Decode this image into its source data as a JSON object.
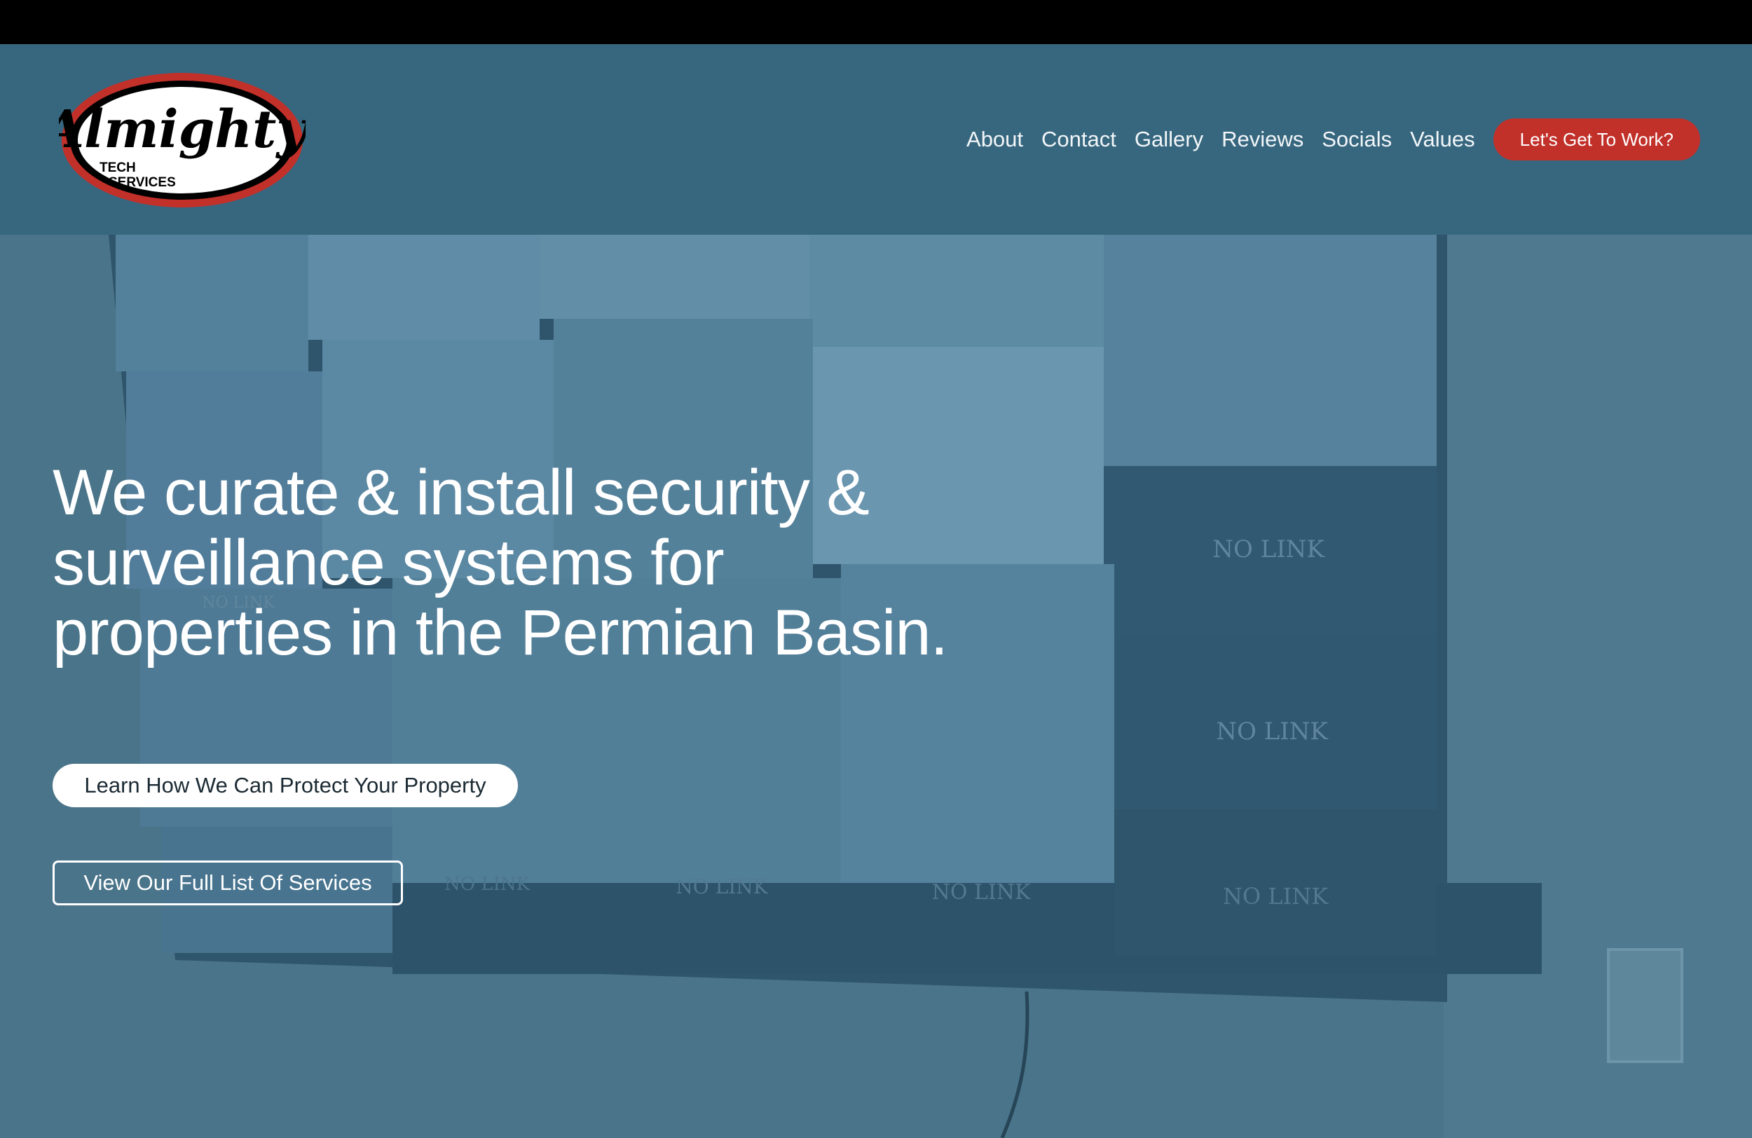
{
  "logo": {
    "script": "Almighty",
    "line1": "TECH",
    "line2": "SERVICES"
  },
  "nav": {
    "items": [
      "About",
      "Contact",
      "Gallery",
      "Reviews",
      "Socials",
      "Values"
    ],
    "cta_label": "Let's Get To Work?"
  },
  "hero": {
    "headline_lines": [
      "We curate & install security &",
      "surveillance systems for",
      "properties in the Permian Basin."
    ],
    "primary_button": "Learn How We Can Protect Your Property",
    "secondary_button": "View Our Full List Of Services",
    "monitor_labels": [
      "NO LINK",
      "NO LINK",
      "NO LINK",
      "NO LINK",
      "NO LINK",
      "NO LINK",
      "NO LINK"
    ]
  },
  "colors": {
    "header_bg": "#37677f",
    "accent_red": "#c2302a",
    "hero_overlay": "#3d6f8c"
  }
}
